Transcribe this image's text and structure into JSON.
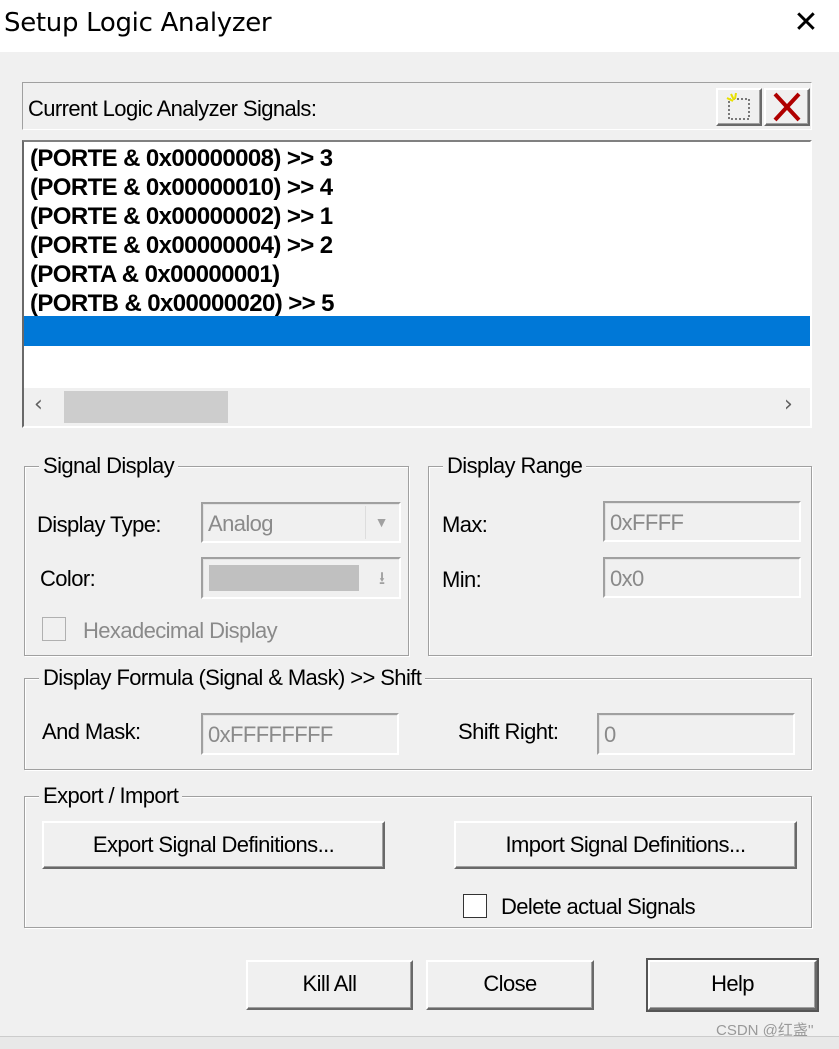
{
  "window": {
    "title": "Setup Logic Analyzer",
    "close_icon": "close-icon"
  },
  "signals": {
    "label": "Current Logic Analyzer Signals:",
    "new_icon": "new-signal-icon",
    "delete_icon": "delete-x-icon",
    "delete_color": "#c00000",
    "items": [
      "(PORTE & 0x00000008) >> 3",
      "(PORTE & 0x00000010) >> 4",
      "(PORTE & 0x00000002) >> 1",
      "(PORTE & 0x00000004) >> 2",
      "(PORTA & 0x00000001)",
      "(PORTB & 0x00000020) >> 5"
    ],
    "selected_color": "#0078d7"
  },
  "signal_display": {
    "title": "Signal Display",
    "display_type_label": "Display Type:",
    "display_type_value": "Analog",
    "color_label": "Color:",
    "hex_label": "Hexadecimal Display",
    "hex_checked": false
  },
  "display_range": {
    "title": "Display Range",
    "max_label": "Max:",
    "max_value": "0xFFFF",
    "min_label": "Min:",
    "min_value": "0x0"
  },
  "formula": {
    "title": "Display Formula (Signal & Mask) >> Shift",
    "and_mask_label": "And Mask:",
    "and_mask_value": "0xFFFFFFFF",
    "shift_label": "Shift Right:",
    "shift_value": "0"
  },
  "export_import": {
    "title": "Export / Import",
    "export_label": "Export Signal Definitions...",
    "import_label": "Import Signal Definitions...",
    "delete_label": "Delete actual Signals",
    "delete_checked": false
  },
  "buttons": {
    "kill_all": "Kill All",
    "close": "Close",
    "help": "Help"
  },
  "watermark": "CSDN @红盏''"
}
